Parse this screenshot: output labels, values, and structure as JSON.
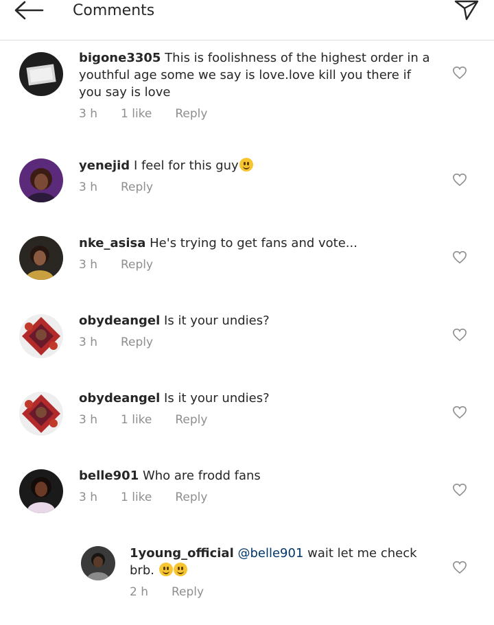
{
  "header": {
    "title": "Comments"
  },
  "comments": [
    {
      "username": "bigone3305",
      "text": "This is foolishness of the highest order in a youthful age some we say is love.love kill you there if you say is love",
      "time": "3 h",
      "likes": "1 like",
      "reply": "Reply"
    },
    {
      "username": "yenejid",
      "text": "I feel for this guy",
      "time": "3 h",
      "reply": "Reply"
    },
    {
      "username": "nke_asisa",
      "text": "He's trying to get fans and vote...",
      "time": "3 h",
      "reply": "Reply"
    },
    {
      "username": "obydeangel",
      "text": "Is it your undies?",
      "time": "3 h",
      "reply": "Reply"
    },
    {
      "username": "obydeangel",
      "text": "Is it your undies?",
      "time": "3 h",
      "likes": "1 like",
      "reply": "Reply"
    },
    {
      "username": "belle901",
      "text": "Who are frodd fans",
      "time": "3 h",
      "likes": "1 like",
      "reply": "Reply"
    }
  ],
  "reply_comment": {
    "username": "1young_official",
    "mention": "@belle901",
    "text": "wait let me check brb.",
    "time": "2 h",
    "reply": "Reply"
  },
  "colors": {
    "mention": "#003569",
    "meta": "#8e8e8e",
    "divider": "#dbdbdb"
  }
}
